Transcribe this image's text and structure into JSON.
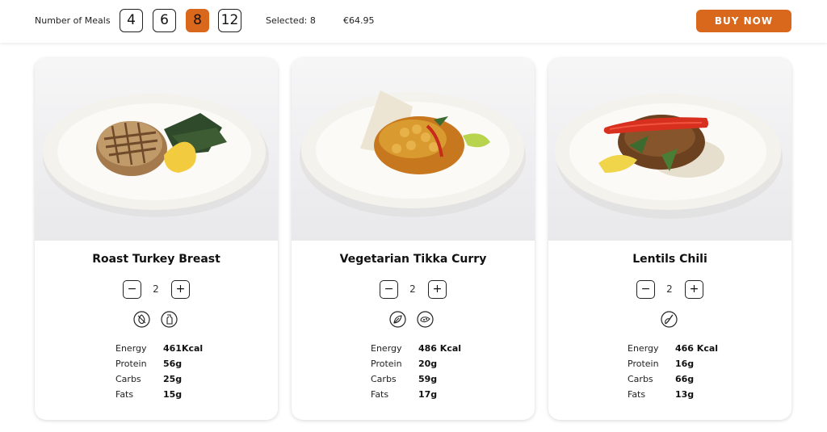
{
  "header": {
    "meals_label": "Number of Meals",
    "meal_options": [
      "4",
      "6",
      "8",
      "12"
    ],
    "active_option": "8",
    "selected_text": "Selected: 8",
    "price": "€64.95",
    "buy_label": "BUY NOW",
    "accent_color": "#d9671c"
  },
  "meals": [
    {
      "title": "Roast Turkey Breast",
      "quantity": "2",
      "diet_icons": [
        "egg-free-icon",
        "dairy-free-icon"
      ],
      "nutrition": [
        {
          "label": "Energy",
          "value": "461Kcal"
        },
        {
          "label": "Protein",
          "value": "56g"
        },
        {
          "label": "Carbs",
          "value": "25g"
        },
        {
          "label": "Fats",
          "value": "15g"
        }
      ]
    },
    {
      "title": "Vegetarian Tikka Curry",
      "quantity": "2",
      "diet_icons": [
        "vegetarian-icon",
        "spicy-icon"
      ],
      "nutrition": [
        {
          "label": "Energy",
          "value": "486 Kcal"
        },
        {
          "label": "Protein",
          "value": "20g"
        },
        {
          "label": "Carbs",
          "value": "59g"
        },
        {
          "label": "Fats",
          "value": "17g"
        }
      ]
    },
    {
      "title": "Lentils Chili",
      "quantity": "2",
      "diet_icons": [
        "chili-icon"
      ],
      "nutrition": [
        {
          "label": "Energy",
          "value": "466 Kcal"
        },
        {
          "label": "Protein",
          "value": "16g"
        },
        {
          "label": "Carbs",
          "value": "66g"
        },
        {
          "label": "Fats",
          "value": "13g"
        }
      ]
    }
  ]
}
